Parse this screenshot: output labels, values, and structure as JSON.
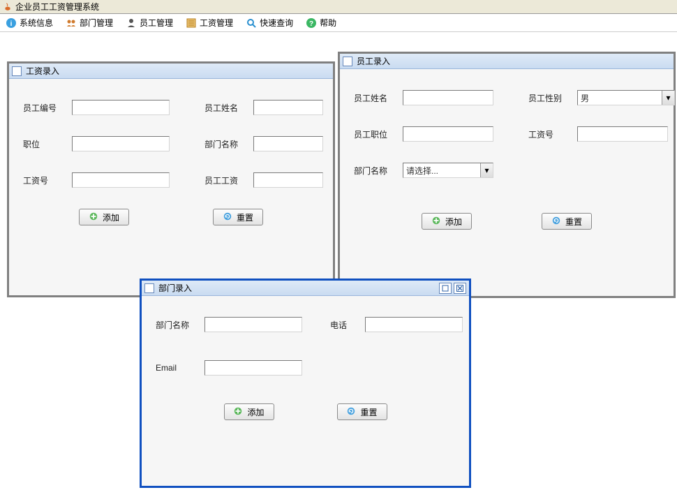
{
  "app": {
    "title": "企业员工工资管理系统"
  },
  "menu": {
    "systemInfo": "系统信息",
    "deptMgmt": "部门管理",
    "empMgmt": "员工管理",
    "salaryMgmt": "工资管理",
    "quickQuery": "快速查询",
    "help": "帮助"
  },
  "salaryWindow": {
    "title": "工资录入",
    "empIdLabel": "员工编号",
    "empNameLabel": "员工姓名",
    "positionLabel": "职位",
    "deptNameLabel": "部门名称",
    "salaryIdLabel": "工资号",
    "empSalaryLabel": "员工工资",
    "addBtn": "添加",
    "resetBtn": "重置"
  },
  "empWindow": {
    "title": "员工录入",
    "empNameLabel": "员工姓名",
    "empGenderLabel": "员工性别",
    "genderSelected": "男",
    "empPositionLabel": "员工职位",
    "salaryIdLabel": "工资号",
    "deptNameLabel": "部门名称",
    "deptSelected": "请选择...",
    "addBtn": "添加",
    "resetBtn": "重置"
  },
  "deptWindow": {
    "title": "部门录入",
    "deptNameLabel": "部门名称",
    "phoneLabel": "电话",
    "emailLabel": "Email",
    "addBtn": "添加",
    "resetBtn": "重置"
  }
}
